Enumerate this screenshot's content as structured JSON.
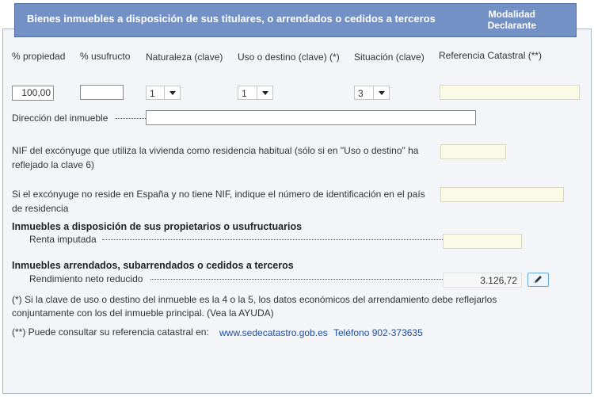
{
  "header": {
    "title": "Bienes inmuebles a disposición de sus titulares, o arrendados o cedidos a terceros",
    "modalidad_line1": "Modalidad",
    "modalidad_line2": "Declarante"
  },
  "columns": {
    "propiedad": "% propiedad",
    "usufructo": "% usufructo",
    "naturaleza": "Naturaleza (clave)",
    "uso": "Uso o destino (clave) (*)",
    "situacion": "Situación (clave)",
    "referencia": "Referencia Catastral (**)"
  },
  "values": {
    "propiedad": "100,00",
    "usufructo": "",
    "naturaleza": "1",
    "uso": "1",
    "situacion": "3",
    "referencia": ""
  },
  "direccion_label": "Dirección del inmueble",
  "nif_line1": "NIF del excónyuge que utiliza la vivienda como residencia habitual (sólo si en \"Uso o destino\" ha",
  "nif_line2": "reflejado la clave 6)",
  "extranjero_line1": "Si el excónyuge no reside en España y no tiene NIF, indique el número de identificación en el país",
  "extranjero_line2": "de residencia",
  "section1": {
    "title": "Inmuebles a disposición de sus propietarios o usufructuarios",
    "label": "Renta imputada"
  },
  "section2": {
    "title": "Inmuebles arrendados, subarrendados o cedidos a terceros",
    "label": "Rendimiento neto reducido",
    "value": "3.126,72"
  },
  "note1_line1": "(*) Si la clave de uso o destino del inmueble es la 4 o la 5, los datos económicos del arrendamiento debe reflejarlos",
  "note1_line2": "conjuntamente con los del inmueble principal. (Vea la AYUDA)",
  "note2_prefix": "(**) Puede consultar su referencia catastral en:",
  "note2_link": "www.sedecatastro.gob.es",
  "note2_phone": "Teléfono 902-373635"
}
